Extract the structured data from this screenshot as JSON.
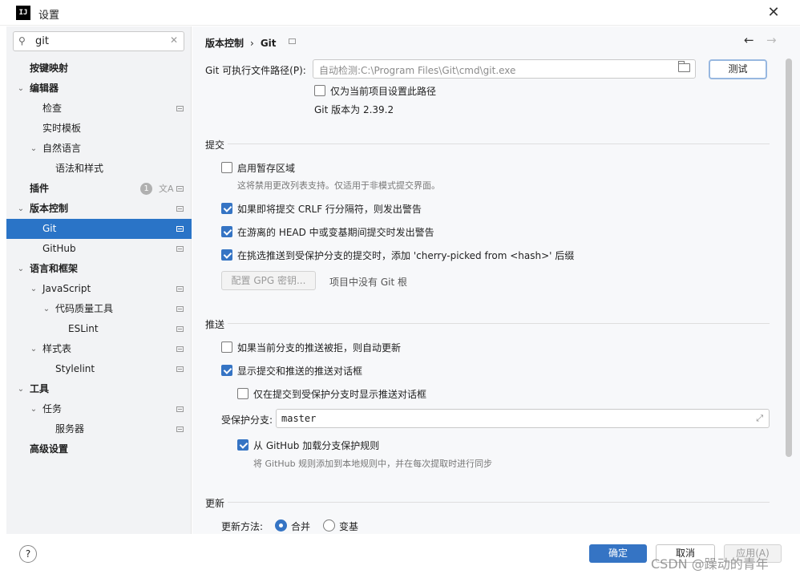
{
  "window": {
    "logo": "IJ",
    "title": "设置"
  },
  "search": {
    "value": "git"
  },
  "sidebar": {
    "items": [
      {
        "label": "按键映射"
      },
      {
        "label": "编辑器"
      },
      {
        "label": "检查"
      },
      {
        "label": "实时模板"
      },
      {
        "label": "自然语言"
      },
      {
        "label": "语法和样式"
      },
      {
        "label": "插件",
        "badge": "1"
      },
      {
        "label": "版本控制"
      },
      {
        "label": "Git"
      },
      {
        "label": "GitHub"
      },
      {
        "label": "语言和框架"
      },
      {
        "label": "JavaScript"
      },
      {
        "label": "代码质量工具"
      },
      {
        "label": "ESLint"
      },
      {
        "label": "样式表"
      },
      {
        "label": "Stylelint"
      },
      {
        "label": "工具"
      },
      {
        "label": "任务"
      },
      {
        "label": "服务器"
      },
      {
        "label": "高级设置"
      }
    ]
  },
  "breadcrumb": {
    "parent": "版本控制",
    "separator": "›",
    "current": "Git"
  },
  "git_path": {
    "label": "Git 可执行文件路径(P):",
    "placeholder": "自动检测:C:\\Program Files\\Git\\cmd\\git.exe",
    "test_button": "测试",
    "project_only_label": "仅为当前项目设置此路径",
    "version_text": "Git 版本为 2.39.2"
  },
  "commit": {
    "title": "提交",
    "staging_label": "启用暂存区域",
    "staging_hint": "这将禁用更改列表支持。仅适用于非模式提交界面。",
    "crlf_label": "如果即将提交 CRLF 行分隔符，则发出警告",
    "detached_label": "在游离的 HEAD 中或变基期间提交时发出警告",
    "cherry_label": "在挑选推送到受保护分支的提交时，添加 'cherry-picked from <hash>' 后缀",
    "gpg_button": "配置 GPG 密钥...",
    "gpg_hint": "项目中没有 Git 根"
  },
  "push": {
    "title": "推送",
    "auto_update_label": "如果当前分支的推送被拒，则自动更新",
    "show_dialog_label": "显示提交和推送的推送对话框",
    "protected_only_label": "仅在提交到受保护分支时显示推送对话框",
    "protected_branches_label": "受保护分支:",
    "protected_branches_value": "master",
    "github_rules_label": "从 GitHub 加载分支保护规则",
    "github_rules_hint": "将 GitHub 规则添加到本地规则中，并在每次提取时进行同步"
  },
  "update": {
    "title": "更新",
    "method_label": "更新方法:",
    "merge_label": "合并",
    "rebase_label": "变基"
  },
  "footer": {
    "help": "?",
    "ok": "确定",
    "cancel": "取消",
    "apply": "应用(A)"
  },
  "watermark": "CSDN @躁动的青年",
  "colors": {
    "selection": "#2a74c7",
    "accent": "#3574c4"
  }
}
